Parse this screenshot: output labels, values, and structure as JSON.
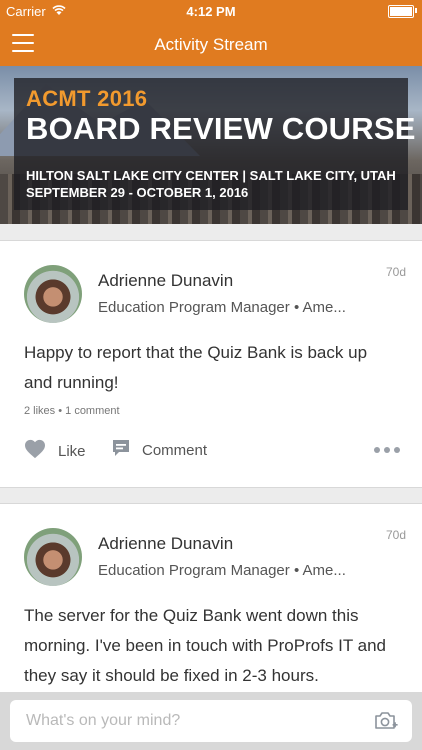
{
  "status_bar": {
    "carrier": "Carrier",
    "time": "4:12 PM"
  },
  "nav": {
    "title": "Activity Stream"
  },
  "banner": {
    "line1": "ACMT 2016",
    "line2": "BOARD REVIEW COURSE",
    "line3": "HILTON SALT LAKE CITY CENTER | SALT LAKE CITY, UTAH",
    "line4": "SEPTEMBER 29 - OCTOBER 1, 2016"
  },
  "posts": [
    {
      "author": "Adrienne Dunavin",
      "role": "Education Program Manager • Ame...",
      "age": "70d",
      "body": "Happy to report that the Quiz Bank is back up and running!",
      "stats": "2 likes • 1 comment",
      "like_label": "Like",
      "comment_label": "Comment"
    },
    {
      "author": "Adrienne Dunavin",
      "role": "Education Program Manager • Ame...",
      "age": "70d",
      "body": "The server for the Quiz Bank went down this morning. I've been in touch with ProProfs IT and they say it should be fixed in 2-3 hours."
    }
  ],
  "composer": {
    "placeholder": "What's on your mind?"
  },
  "icons": {
    "menu": "menu-icon",
    "wifi": "wifi-icon",
    "battery": "battery-icon",
    "like": "heart-icon",
    "comment": "comment-icon",
    "more": "more-dots-icon",
    "camera": "camera-add-icon"
  },
  "colors": {
    "accent": "#e07b20",
    "banner_title": "#f29a2e",
    "background": "#ececec"
  }
}
